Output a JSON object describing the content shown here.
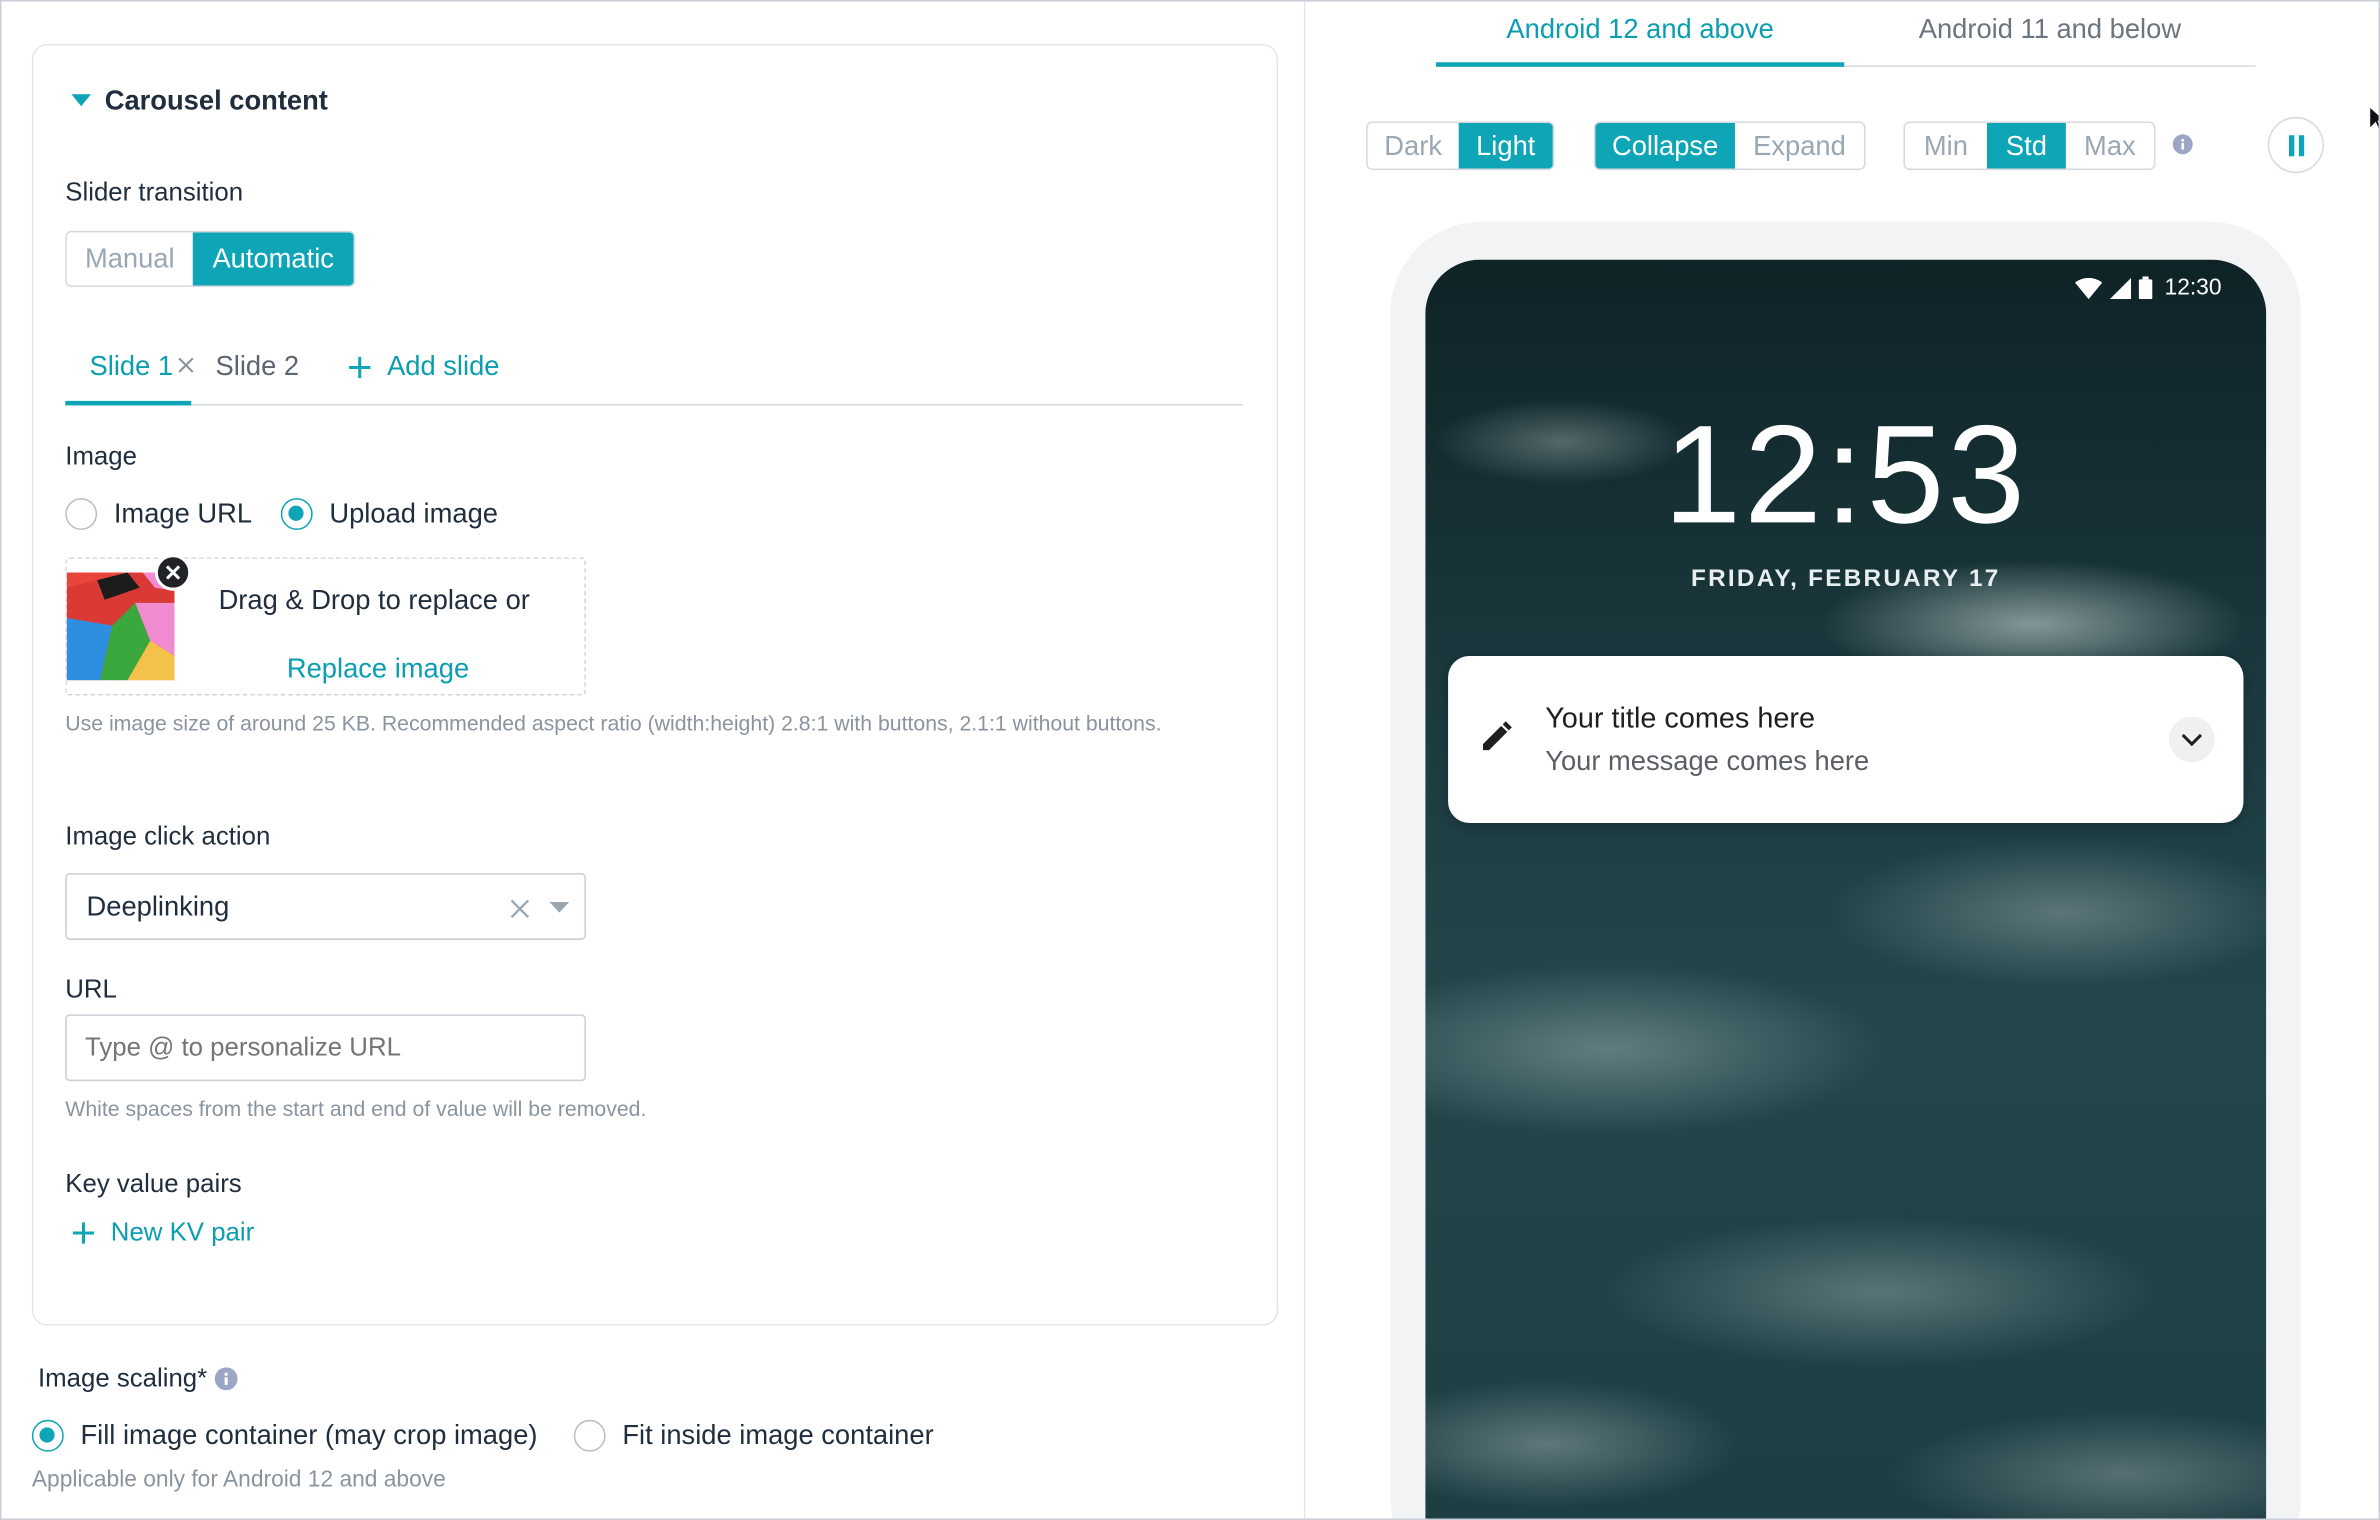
{
  "left": {
    "section_title": "Carousel content",
    "slider_transition": {
      "label": "Slider transition",
      "options": [
        "Manual",
        "Automatic"
      ],
      "selected": "Automatic"
    },
    "slide_tabs": {
      "tabs": [
        "Slide 1",
        "Slide 2"
      ],
      "active": "Slide 1",
      "add_label": "Add slide"
    },
    "image": {
      "label": "Image",
      "source_options": [
        "Image URL",
        "Upload image"
      ],
      "selected": "Upload image",
      "drop_text": "Drag & Drop to replace or",
      "replace_link": "Replace image",
      "hint": "Use image size of around 25 KB. Recommended aspect ratio (width:height) 2.8:1 with buttons, 2.1:1 without buttons."
    },
    "click_action": {
      "label": "Image click action",
      "value": "Deeplinking"
    },
    "url": {
      "label": "URL",
      "placeholder": "Type @ to personalize URL",
      "hint": "White spaces from the start and end of value will be removed."
    },
    "kv": {
      "label": "Key value pairs",
      "add_label": "New KV pair"
    },
    "scaling": {
      "label": "Image scaling*",
      "options": [
        "Fill image container (may crop image)",
        "Fit inside image container"
      ],
      "selected": "Fill image container (may crop image)",
      "hint": "Applicable only for Android 12 and above"
    }
  },
  "right": {
    "tabs": [
      "Android 12 and above",
      "Android 11 and below"
    ],
    "active_tab": "Android 12 and above",
    "theme": {
      "options": [
        "Dark",
        "Light"
      ],
      "selected": "Light"
    },
    "view": {
      "options": [
        "Collapse",
        "Expand"
      ],
      "selected": "Collapse"
    },
    "size": {
      "options": [
        "Min",
        "Std",
        "Max"
      ],
      "selected": "Std"
    },
    "phone": {
      "status_time": "12:30",
      "clock": "12:53",
      "date": "FRIDAY, FEBRUARY 17",
      "notification": {
        "title": "Your title comes here",
        "message": "Your message comes here"
      }
    }
  },
  "colors": {
    "accent": "#0ea5b6",
    "link": "#0b9eb0"
  },
  "icons": [
    "caret-down-icon",
    "close-icon",
    "plus-icon",
    "chevron-down-icon",
    "info-icon",
    "pause-icon",
    "pencil-icon",
    "wifi-icon",
    "signal-icon",
    "battery-icon",
    "cursor-icon"
  ]
}
